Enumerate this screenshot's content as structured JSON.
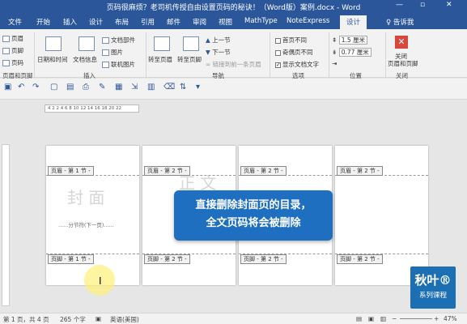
{
  "title_bar": {
    "title": "页码很麻烦？老司机传授自由设置页码的秘诀！（Word版）案例.docx - Word",
    "minimize": "—",
    "restore": "▫",
    "close": "✕"
  },
  "tabs": [
    "文件",
    "开始",
    "插入",
    "设计",
    "布局",
    "引用",
    "邮件",
    "审阅",
    "视图",
    "MathType",
    "NoteExpress",
    "设计",
    "♀ 告诉我"
  ],
  "ribbon": {
    "hf_group": {
      "header": "页眉",
      "footer": "页脚",
      "page_number": "页码",
      "label": "页眉和页脚"
    },
    "insert_group": {
      "date_time": "日期和时间",
      "doc_info": "文档信息",
      "doc_parts": "文档部件",
      "picture": "图片",
      "online_picture": "联机图片",
      "label": "插入"
    },
    "nav_group": {
      "goto_header": "转至页眉",
      "goto_footer": "转至页脚",
      "prev": "上一节",
      "next": "下一节",
      "link_prev": "链接到前一条页眉",
      "label": "导航"
    },
    "options_group": {
      "diff_first": "首页不同",
      "diff_odd_even": "奇偶页不同",
      "show_text": "显示文档文字",
      "label": "选项"
    },
    "position_group": {
      "top_value": "1.5 厘米",
      "bottom_value": "0.77 厘米",
      "label": "位置"
    },
    "close_group": {
      "close": "关闭",
      "close2": "页眉和页脚",
      "label": "关闭"
    }
  },
  "ruler": {
    "ticks": "4 2 2 4 6 8 10 12 14 16 18 20 22"
  },
  "pages": [
    {
      "header": "页眉 - 第 1 节 -",
      "footer": "页脚 - 第 1 节 -",
      "bigtext": "封 面",
      "section_break": "......分节符(下一页)......"
    },
    {
      "header": "页眉 - 第 2 节 -",
      "footer": "页脚 - 第 2 节 -",
      "bigtext": "正 文"
    },
    {
      "header": "页眉 - 第 2 节 -",
      "footer": "页脚 - 第 2 节 -"
    },
    {
      "header": "页眉 - 第 2 节 -",
      "footer": "页脚 - 第 2 节 -"
    }
  ],
  "callout": {
    "line1": "直接删除封面页的目录，",
    "line2": "全文页码将会被删除"
  },
  "logo": {
    "line1": "秋叶®",
    "line2": "系列课程"
  },
  "status": {
    "page": "第 1 页，共 4 页",
    "words": "265 个字",
    "lang": "英语(美国)",
    "zoom": "47%"
  },
  "colors": {
    "accent": "#2b579a",
    "callout": "#1f6fc0"
  }
}
